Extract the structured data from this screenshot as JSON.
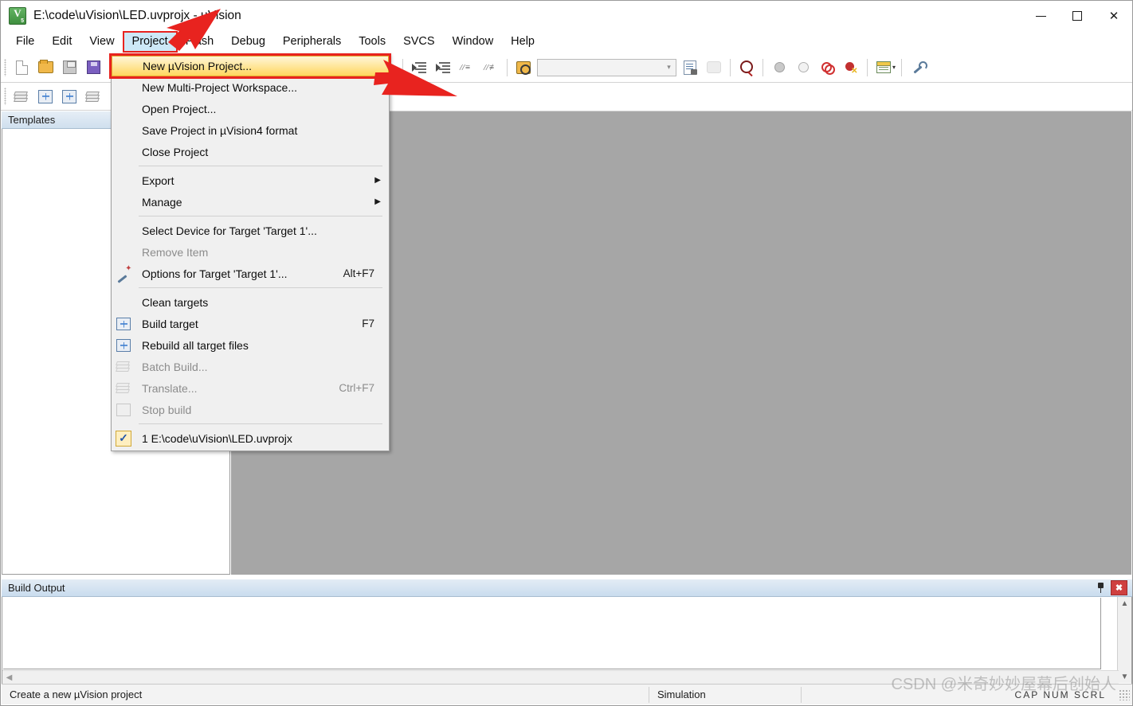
{
  "window": {
    "title": "E:\\code\\uVision\\LED.uvprojx - µVision",
    "app_icon": "uvision-icon",
    "minimize_label": "",
    "maximize_label": "",
    "close_label": "✕"
  },
  "menubar": {
    "items": [
      {
        "label": "File",
        "active": false
      },
      {
        "label": "Edit",
        "active": false
      },
      {
        "label": "View",
        "active": false
      },
      {
        "label": "Project",
        "active": true
      },
      {
        "label": "Flash",
        "active": false
      },
      {
        "label": "Debug",
        "active": false
      },
      {
        "label": "Peripherals",
        "active": false
      },
      {
        "label": "Tools",
        "active": false
      },
      {
        "label": "SVCS",
        "active": false
      },
      {
        "label": "Window",
        "active": false
      },
      {
        "label": "Help",
        "active": false
      }
    ]
  },
  "toolbar1": {
    "buttons": [
      {
        "name": "new-file-icon"
      },
      {
        "name": "open-file-icon"
      },
      {
        "name": "save-icon"
      },
      {
        "name": "save-all-icon"
      }
    ],
    "edit_buttons": [
      {
        "name": "indent-icon"
      },
      {
        "name": "outdent-icon"
      },
      {
        "name": "comment-icon"
      },
      {
        "name": "uncomment-icon"
      }
    ],
    "bookmark": {
      "name": "bookmark-icon"
    },
    "combo": {
      "value": "",
      "placeholder": ""
    },
    "right_buttons": [
      {
        "name": "file-properties-icon"
      },
      {
        "name": "debug-settings-icon"
      },
      {
        "name": "find-in-files-icon"
      },
      {
        "name": "breakpoint-disabled-icon"
      },
      {
        "name": "breakpoint-open-icon"
      },
      {
        "name": "breakpoint-toggle-icon"
      },
      {
        "name": "breakpoint-kill-icon"
      },
      {
        "name": "manage-windows-icon"
      },
      {
        "name": "configuration-wizard-icon"
      }
    ]
  },
  "toolbar2": {
    "buttons": [
      {
        "name": "batch-build-icon"
      },
      {
        "name": "build-target-icon"
      },
      {
        "name": "rebuild-all-icon"
      },
      {
        "name": "batch-setup-icon"
      }
    ],
    "right_buttons": [
      {
        "name": "target-options-icon"
      },
      {
        "name": "manage-runtime-icon"
      }
    ]
  },
  "left_panel": {
    "tab_label": "Templates"
  },
  "project_menu": {
    "items": [
      {
        "label": "New µVision Project...",
        "accel": "",
        "icon": "",
        "disabled": false,
        "highlight": true,
        "submenu": false
      },
      {
        "label": "New Multi-Project Workspace...",
        "accel": "",
        "icon": "",
        "disabled": false,
        "highlight": false,
        "submenu": false
      },
      {
        "label": "Open Project...",
        "accel": "",
        "icon": "",
        "disabled": false,
        "highlight": false,
        "submenu": false
      },
      {
        "label": "Save Project in µVision4 format",
        "accel": "",
        "icon": "",
        "disabled": false,
        "highlight": false,
        "submenu": false
      },
      {
        "label": "Close Project",
        "accel": "",
        "icon": "",
        "disabled": false,
        "highlight": false,
        "submenu": false
      },
      {
        "separator": true
      },
      {
        "label": "Export",
        "accel": "",
        "icon": "",
        "disabled": false,
        "highlight": false,
        "submenu": true
      },
      {
        "label": "Manage",
        "accel": "",
        "icon": "",
        "disabled": false,
        "highlight": false,
        "submenu": true
      },
      {
        "separator": true
      },
      {
        "label": "Select Device for Target 'Target 1'...",
        "accel": "",
        "icon": "",
        "disabled": false,
        "highlight": false,
        "submenu": false
      },
      {
        "label": "Remove Item",
        "accel": "",
        "icon": "",
        "disabled": true,
        "highlight": false,
        "submenu": false
      },
      {
        "label": "Options for Target 'Target 1'...",
        "accel": "Alt+F7",
        "icon": "target-options-icon",
        "disabled": false,
        "highlight": false,
        "submenu": false
      },
      {
        "separator": true
      },
      {
        "label": "Clean targets",
        "accel": "",
        "icon": "",
        "disabled": false,
        "highlight": false,
        "submenu": false
      },
      {
        "label": "Build target",
        "accel": "F7",
        "icon": "build-target-icon",
        "disabled": false,
        "highlight": false,
        "submenu": false
      },
      {
        "label": "Rebuild all target files",
        "accel": "",
        "icon": "rebuild-all-icon",
        "disabled": false,
        "highlight": false,
        "submenu": false
      },
      {
        "label": "Batch Build...",
        "accel": "",
        "icon": "batch-build-icon",
        "disabled": true,
        "highlight": false,
        "submenu": false
      },
      {
        "label": "Translate...",
        "accel": "Ctrl+F7",
        "icon": "translate-icon",
        "disabled": true,
        "highlight": false,
        "submenu": false
      },
      {
        "label": "Stop build",
        "accel": "",
        "icon": "stop-build-icon",
        "disabled": true,
        "highlight": false,
        "submenu": false
      },
      {
        "separator": true
      },
      {
        "label": "1 E:\\code\\uVision\\LED.uvprojx",
        "accel": "",
        "icon": "recent-check-icon",
        "disabled": false,
        "highlight": false,
        "submenu": false
      }
    ]
  },
  "build_output": {
    "title": "Build Output",
    "pin_icon": "pin-icon",
    "close_icon": "close-icon",
    "content": ""
  },
  "statusbar": {
    "message": "Create a new µVision project",
    "simulation": "Simulation",
    "flags": "CAP NUM SCRL"
  },
  "watermark": {
    "text": "CSDN @米奇妙妙屋幕后创始人"
  },
  "colors": {
    "highlight_menu_bg": "#ffd75e",
    "annotation_red": "#e8231f",
    "menubar_active_bg": "#cde8f7",
    "panel_tab_bg": "#cfdfee",
    "mdi_bg": "#a6a6a6"
  }
}
